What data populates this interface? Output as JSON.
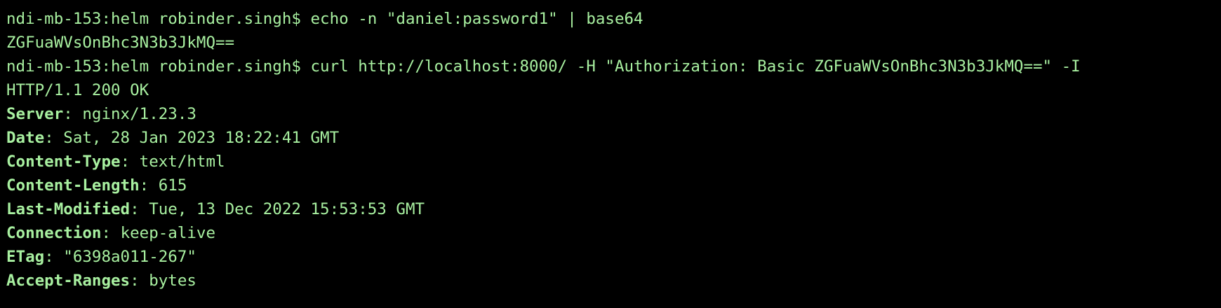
{
  "terminal": {
    "colors": {
      "background": "#000000",
      "text": "#a8f0a0"
    },
    "commands": [
      {
        "prompt": "ndi-mb-153:helm robinder.singh$ ",
        "command": "echo -n \"daniel:password1\" | base64",
        "output": "ZGFuaWVsOnBhc3N3b3JkMQ=="
      },
      {
        "prompt": "ndi-mb-153:helm robinder.singh$ ",
        "command": "curl http://localhost:8000/ -H \"Authorization: Basic ZGFuaWVsOnBhc3N3b3JkMQ==\" -I"
      }
    ],
    "response": {
      "status_line": "HTTP/1.1 200 OK",
      "headers": [
        {
          "name": "Server",
          "sep": ": ",
          "value": "nginx/1.23.3"
        },
        {
          "name": "Date",
          "sep": ": ",
          "value": "Sat, 28 Jan 2023 18:22:41 GMT"
        },
        {
          "name": "Content-Type",
          "sep": ": ",
          "value": "text/html"
        },
        {
          "name": "Content-Length",
          "sep": ": ",
          "value": "615"
        },
        {
          "name": "Last-Modified",
          "sep": ": ",
          "value": "Tue, 13 Dec 2022 15:53:53 GMT"
        },
        {
          "name": "Connection",
          "sep": ": ",
          "value": "keep-alive"
        },
        {
          "name": "ETag",
          "sep": ": ",
          "value": "\"6398a011-267\""
        },
        {
          "name": "Accept-Ranges",
          "sep": ": ",
          "value": "bytes"
        }
      ]
    }
  }
}
